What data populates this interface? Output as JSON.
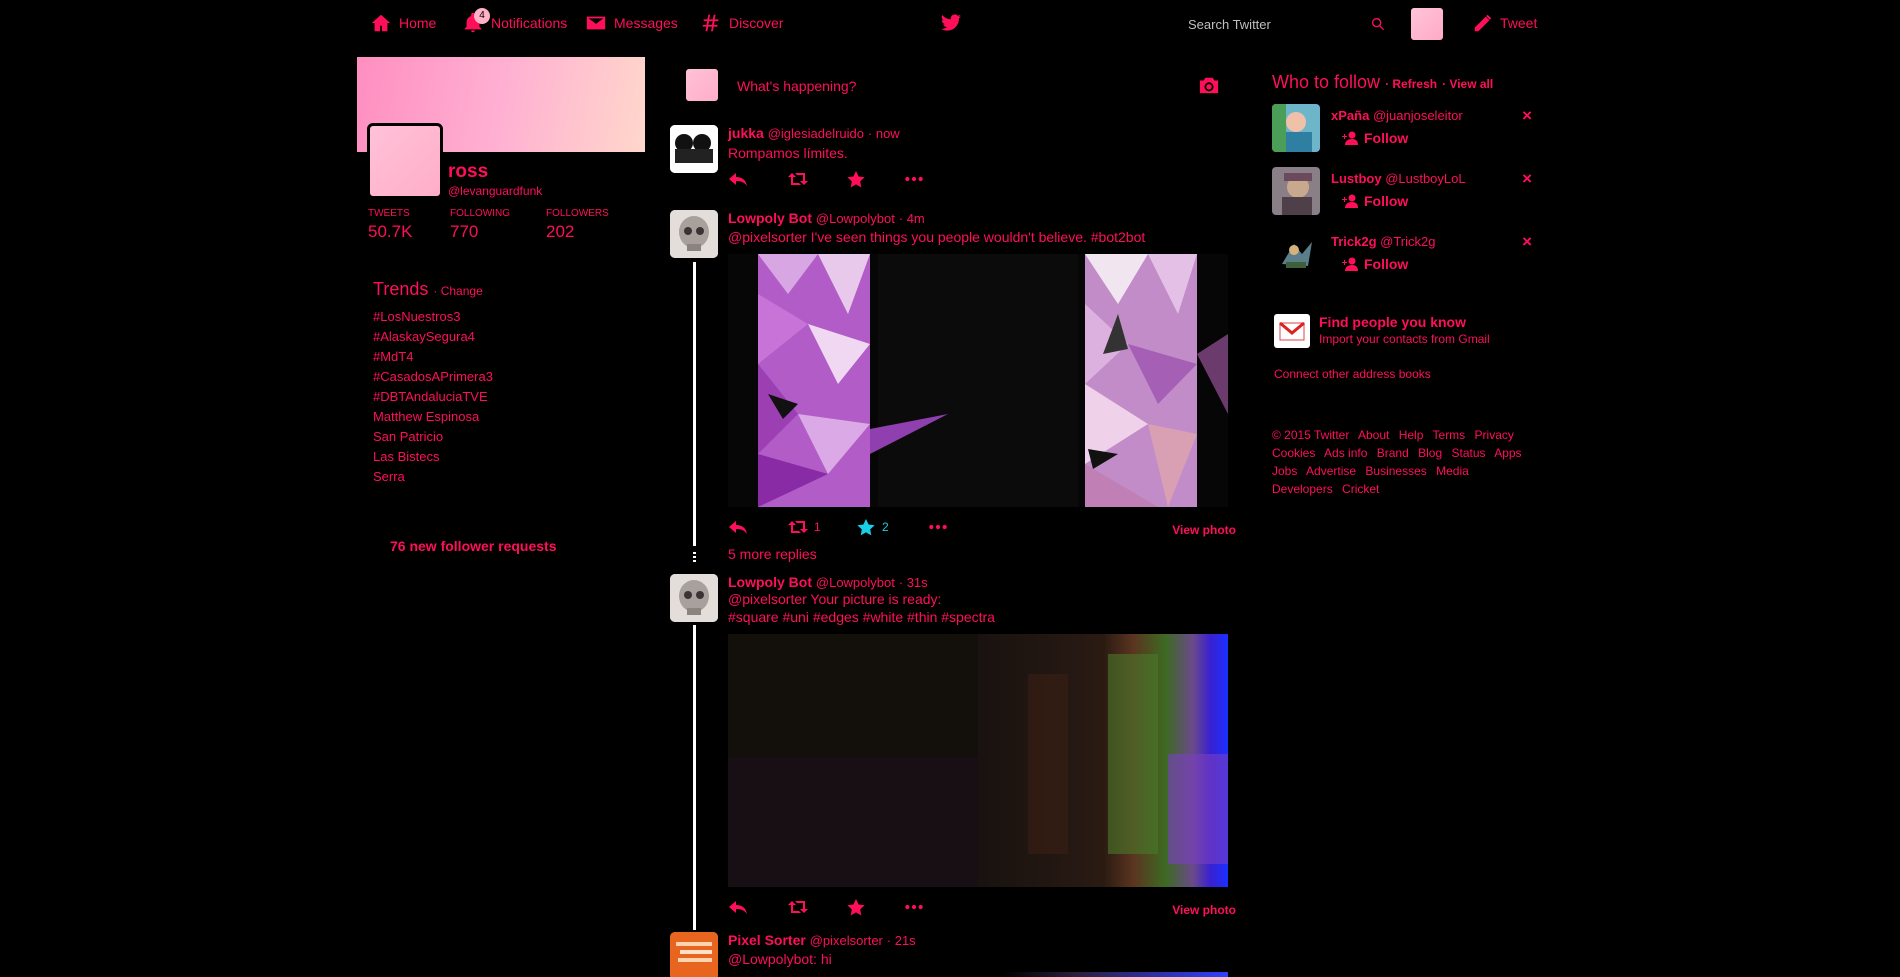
{
  "nav": {
    "home": "Home",
    "notifications": "Notifications",
    "notifications_badge": "4",
    "messages": "Messages",
    "discover": "Discover",
    "search_placeholder": "Search Twitter",
    "tweet": "Tweet"
  },
  "profile": {
    "name": "ross",
    "handle": "@levanguardfunk",
    "stats": [
      {
        "label": "Tweets",
        "value": "50.7K"
      },
      {
        "label": "Following",
        "value": "770"
      },
      {
        "label": "Followers",
        "value": "202"
      }
    ]
  },
  "trends": {
    "title": "Trends",
    "change": "· Change",
    "items": [
      "#LosNuestros3",
      "#AlaskaySegura4",
      "#MdT4",
      "#CasadosAPrimera3",
      "#DBTAndaluciaTVE",
      "Matthew Espinosa",
      "San Patricio",
      "Las Bistecs",
      "Serra"
    ]
  },
  "follow_requests": "76 new follower requests",
  "compose": {
    "placeholder": "What's happening?"
  },
  "tweets": [
    {
      "name": "jukka",
      "handle": "@iglesiadelruido",
      "time": "· now",
      "text": "Rompamos límites."
    },
    {
      "name": "Lowpoly Bot",
      "handle": "@Lowpolybot",
      "time": "· 4m",
      "text": "@pixelsorter I've seen things you people wouldn't believe. #bot2bot",
      "retweets": "1",
      "favorites": "2",
      "view_photo": "View photo"
    },
    {
      "more_replies": "5 more replies"
    },
    {
      "name": "Lowpoly Bot",
      "handle": "@Lowpolybot",
      "time": "· 31s",
      "text_line1": "@pixelsorter Your picture is ready:",
      "text_line2": "#square #uni #edges #white #thin #spectra",
      "view_photo": "View photo"
    },
    {
      "name": "Pixel Sorter",
      "handle": "@pixelsorter",
      "time": "· 21s",
      "text": "@Lowpolybot: hi"
    }
  ],
  "who_to_follow": {
    "title": "Who to follow",
    "refresh": "· Refresh",
    "view_all": "· View all",
    "follow_label": "Follow",
    "suggestions": [
      {
        "name": "xPaña",
        "handle": "@juanjoseleitor"
      },
      {
        "name": "Lustboy",
        "handle": "@LustboyLoL"
      },
      {
        "name": "Trick2g",
        "handle": "@Trick2g"
      }
    ]
  },
  "find_people": {
    "title": "Find people you know",
    "subtitle": "Import your contacts from Gmail",
    "connect": "Connect other address books"
  },
  "footer": {
    "line1": [
      "© 2015 Twitter",
      "About",
      "Help",
      "Terms",
      "Privacy"
    ],
    "line2": [
      "Cookies",
      "Ads info",
      "Brand",
      "Blog",
      "Status",
      "Apps"
    ],
    "line3": [
      "Jobs",
      "Advertise",
      "Businesses",
      "Media"
    ],
    "line4": [
      "Developers",
      "Cricket"
    ]
  },
  "colors": {
    "accent": "#ff0f5a",
    "background": "#000000"
  }
}
